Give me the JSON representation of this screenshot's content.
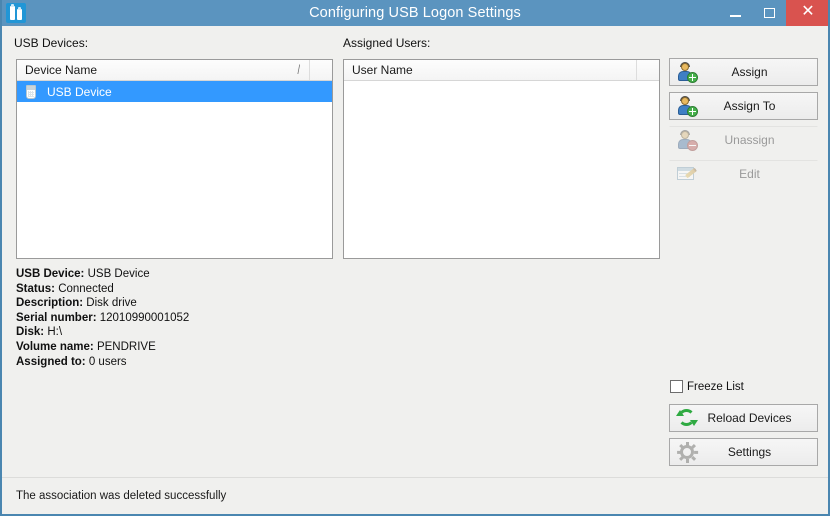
{
  "window": {
    "title": "Configuring USB Logon Settings",
    "app_icon": "usb-devices-icon",
    "controls": {
      "minimize": "minimize-icon",
      "maximize": "maximize-icon",
      "close": "✕"
    },
    "colors": {
      "titlebar": "#5B94BF",
      "frame_border": "#4A86B0",
      "close_button": "#D9534F",
      "selection": "#3399FF",
      "background": "#F0F0EE",
      "accent_green": "#2FAA42"
    }
  },
  "usb_devices_panel": {
    "label": "USB Devices:",
    "column_header": "Device Name",
    "sort_indicator": "/",
    "rows": [
      {
        "name": "USB Device",
        "icon": "usb-stick-icon",
        "selected": true
      }
    ]
  },
  "assigned_users_panel": {
    "label": "Assigned Users:",
    "column_header": "User Name",
    "rows": []
  },
  "action_buttons": [
    {
      "label": "Assign",
      "icon": "user-add-icon",
      "enabled": true
    },
    {
      "label": "Assign To",
      "icon": "user-add-icon",
      "enabled": true
    },
    {
      "label": "Unassign",
      "icon": "user-remove-icon",
      "enabled": false
    },
    {
      "label": "Edit",
      "icon": "edit-pencil-icon",
      "enabled": false
    }
  ],
  "details": [
    {
      "key": "USB Device:",
      "value": "USB Device"
    },
    {
      "key": "Status:",
      "value": "Connected"
    },
    {
      "key": "Description:",
      "value": "Disk drive"
    },
    {
      "key": "Serial number:",
      "value": "12010990001052"
    },
    {
      "key": "Disk:",
      "value": "H:\\"
    },
    {
      "key": "Volume name:",
      "value": "PENDRIVE"
    },
    {
      "key": "Assigned to:",
      "value": "0 users"
    }
  ],
  "freeze_list": {
    "label": "Freeze List",
    "checked": false
  },
  "bottom_buttons": [
    {
      "label": "Reload Devices",
      "icon": "refresh-icon",
      "enabled": true
    },
    {
      "label": "Settings",
      "icon": "gear-icon",
      "enabled": true
    }
  ],
  "statusbar": {
    "message": "The association was deleted successfully"
  }
}
